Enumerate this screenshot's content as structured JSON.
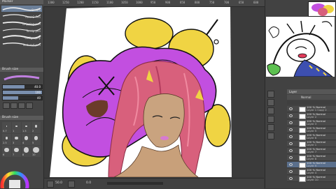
{
  "ruler": {
    "ticks": [
      "1300",
      "1250",
      "1200",
      "1150",
      "1100",
      "1050",
      "1000",
      "950",
      "900",
      "850",
      "800",
      "750",
      "700",
      "650",
      "600"
    ]
  },
  "left_panel": {
    "header_label": "Marker",
    "brushes": [
      {
        "label": "Cream"
      },
      {
        "label": "Real G-Pen"
      },
      {
        "label": "Dripping pen"
      },
      {
        "label": "Turnip pen"
      },
      {
        "label": "Calligraphy"
      },
      {
        "label": "Textured pen"
      }
    ],
    "brush_size_header": "Brush size",
    "sliders": [
      {
        "value": "40.0",
        "fraction": 0.55
      },
      {
        "value": "100",
        "fraction": 1.0
      },
      {
        "value": "40",
        "fraction": 0.4
      }
    ],
    "size_header": "Brush size",
    "size_values": [
      "0.7",
      "1",
      "1.5",
      "2",
      "2.5",
      "3",
      "4",
      "5",
      "6",
      "7",
      "8",
      "10"
    ]
  },
  "right_panel": {
    "layer_header": "Layer",
    "blend_mode": "Normal",
    "layers": [
      {
        "name": "Layer 1 Copy 2",
        "mode": "100 % Normal",
        "selected": false
      },
      {
        "name": "Layer 2",
        "mode": "100 % Normal",
        "selected": false
      },
      {
        "name": "Layer 3",
        "mode": "100 % Normal",
        "selected": false
      },
      {
        "name": "Layer 5",
        "mode": "100 % Normal",
        "selected": false
      },
      {
        "name": "Layer 6",
        "mode": "100 % Normal",
        "selected": false
      },
      {
        "name": "Layer 1",
        "mode": "100 % Normal",
        "selected": false
      },
      {
        "name": "Layer 7",
        "mode": "100 % Normal",
        "selected": false
      },
      {
        "name": "Layer 8",
        "mode": "100 % Normal",
        "selected": false
      },
      {
        "name": "Layer 9",
        "mode": "100 % Normal",
        "selected": true
      },
      {
        "name": "Layer 4",
        "mode": "100 % Normal",
        "selected": false
      },
      {
        "name": "Layer 10",
        "mode": "100 % Normal",
        "selected": false
      }
    ]
  },
  "status": {
    "zoom": "50.0",
    "coords": "0.0"
  },
  "colors": {
    "accent": "#6b7f99",
    "magenta": "#c24fe0",
    "yellow": "#f2d444",
    "hair": "#d8607c"
  }
}
